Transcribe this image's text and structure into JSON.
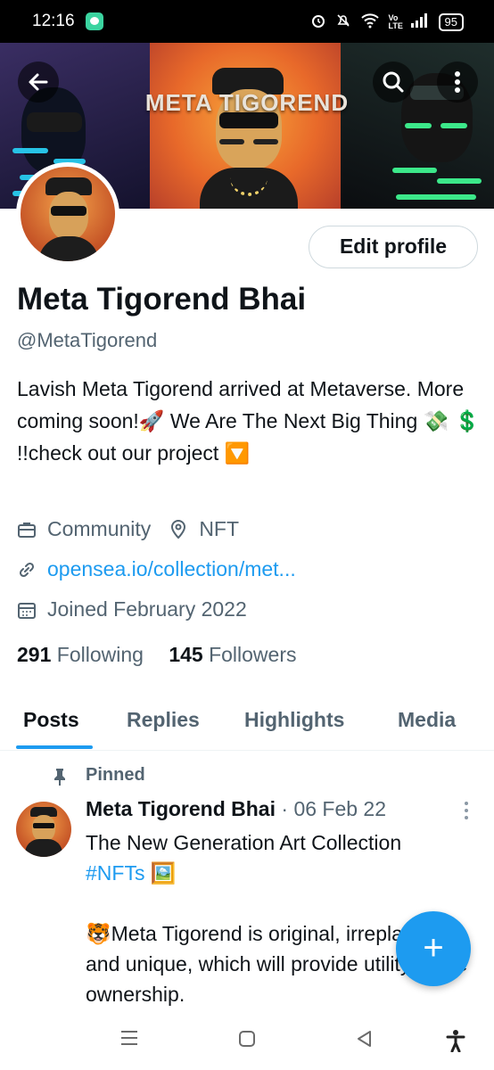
{
  "status_bar": {
    "time": "12:16",
    "icons": [
      "alarm-icon",
      "silent-icon",
      "wifi-icon",
      "volte-icon",
      "signal-icon"
    ],
    "volte": "Vo LTE",
    "battery": "95"
  },
  "header": {
    "banner_title": "META TIGOREND",
    "back_icon": "arrow-left-icon",
    "search_icon": "search-icon",
    "more_icon": "more-vertical-icon"
  },
  "profile": {
    "edit_label": "Edit profile",
    "name": "Meta Tigorend Bhai",
    "handle": "@MetaTigorend",
    "bio": "Lavish Meta Tigorend arrived at Metaverse. More coming soon!🚀 We Are The Next Big Thing 💸 💲 !!check out our project 🔽",
    "category": "Community",
    "location": "NFT",
    "website": "opensea.io/collection/met...",
    "joined": "Joined February 2022",
    "following_count": "291",
    "following_label": "Following",
    "followers_count": "145",
    "followers_label": "Followers"
  },
  "tabs": [
    {
      "label": "Posts",
      "active": true
    },
    {
      "label": "Replies",
      "active": false
    },
    {
      "label": "Highlights",
      "active": false
    },
    {
      "label": "Media",
      "active": false
    }
  ],
  "post": {
    "pinned_label": "Pinned",
    "author": "Meta Tigorend Bhai",
    "date": "· 06 Feb 22",
    "line1": "The New Generation Art Collection",
    "hashtag": "#NFTs",
    "hashtag_emoji": "🖼️",
    "para": "🐯Meta Tigorend is original, irreplaceable and unique, which will provide utility to the ownership."
  },
  "fab": {
    "label": "+"
  },
  "nav": [
    "menu-icon",
    "home-square-icon",
    "back-triangle-icon",
    "accessibility-icon"
  ],
  "colors": {
    "accent": "#1d9bf0",
    "text": "#0f1419",
    "secondary": "#536471"
  }
}
